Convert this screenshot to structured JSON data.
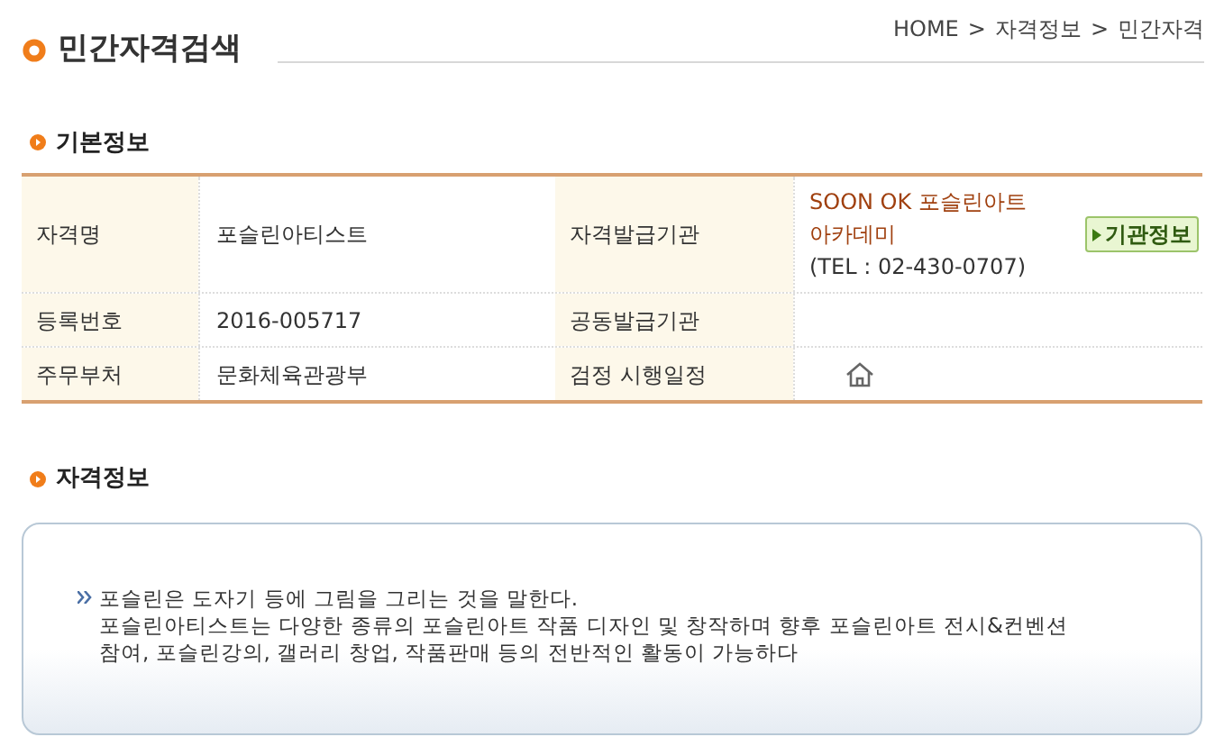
{
  "page_title": "민간자격검색",
  "breadcrumb": [
    "HOME",
    "자격정보",
    "민간자격"
  ],
  "breadcrumb_separator": ">",
  "basic_info": {
    "heading": "기본정보",
    "rows": [
      {
        "label": "자격명",
        "value": "포슬린아티스트",
        "label2": "자격발급기관",
        "kind": "issuer",
        "issuer_lines": [
          "SOON OK 포슬린아트",
          "아카데미"
        ],
        "tel": "(TEL : 02-430-0707)",
        "button": "기관정보"
      },
      {
        "label": "등록번호",
        "value": "2016-005717",
        "label2": "공동발급기관",
        "kind": "empty"
      },
      {
        "label": "주무부처",
        "value": "문화체육관광부",
        "label2": "검정 시행일정",
        "kind": "home"
      }
    ]
  },
  "qualification_info": {
    "heading": "자격정보",
    "lines": [
      "포슬린은 도자기 등에 그림을 그리는 것을 말한다.",
      "포슬린아티스트는 다양한 종류의 포슬린아트 작품 디자인 및 창작하며 향후 포슬린아트 전시&컨벤션",
      "참여, 포슬린강의, 갤러리 창업, 작품판매 등의 전반적인 활동이 가능하다"
    ]
  }
}
